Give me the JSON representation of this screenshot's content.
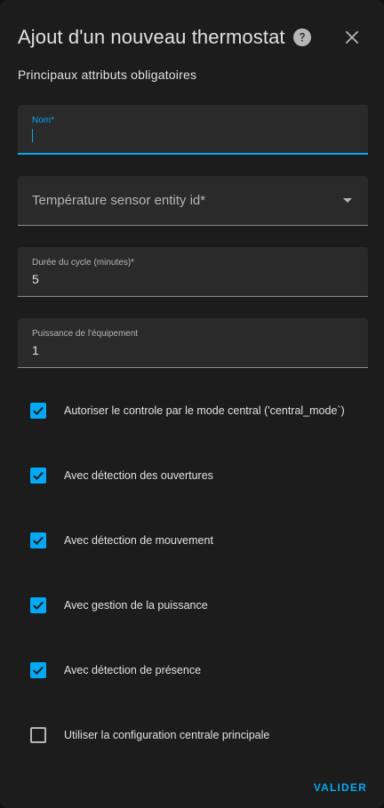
{
  "dialog": {
    "title": "Ajout d'un nouveau thermostat",
    "subtitle": "Principaux attributs obligatoires"
  },
  "fields": {
    "name": {
      "label": "Nom*",
      "value": ""
    },
    "sensor": {
      "label": "Température sensor entity id*",
      "value": ""
    },
    "cycle": {
      "label": "Durée du cycle (minutes)*",
      "value": "5"
    },
    "power": {
      "label": "Puissance de l'équipement",
      "value": "1"
    }
  },
  "options": [
    {
      "label": "Autoriser le controle par le mode central ('central_mode`)",
      "checked": true
    },
    {
      "label": "Avec détection des ouvertures",
      "checked": true
    },
    {
      "label": "Avec détection de mouvement",
      "checked": true
    },
    {
      "label": "Avec gestion de la puissance",
      "checked": true
    },
    {
      "label": "Avec détection de présence",
      "checked": true
    },
    {
      "label": "Utiliser la configuration centrale principale",
      "checked": false
    }
  ],
  "actions": {
    "submit_label": "VALIDER"
  },
  "colors": {
    "accent": "#03a9f4",
    "background": "#1c1c1c",
    "field_background": "#2a2a2a"
  },
  "icons": {
    "help": "help-circle-icon",
    "close": "close-icon",
    "dropdown": "menu-down-icon",
    "check": "checkmark-icon"
  }
}
